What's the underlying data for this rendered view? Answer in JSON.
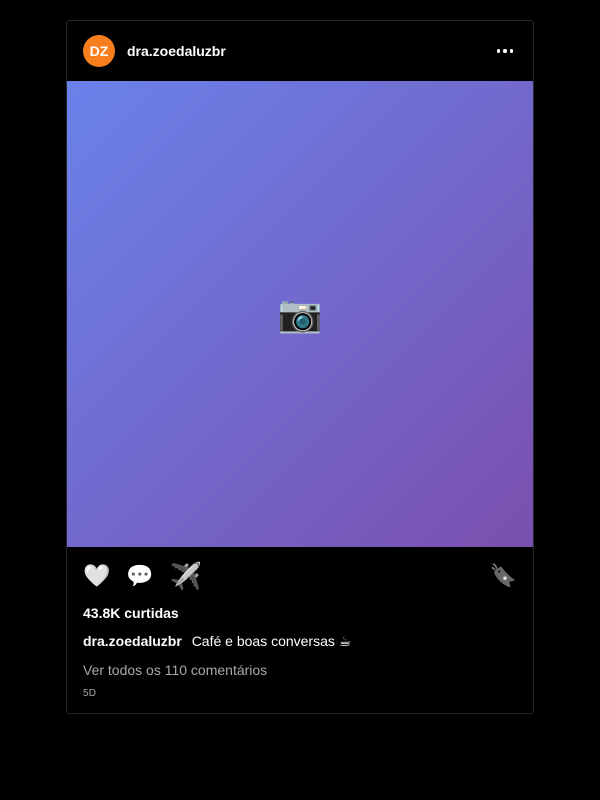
{
  "post": {
    "avatar_initials": "DZ",
    "avatar_color": "#f77f1e",
    "username": "dra.zoedaluzbr",
    "media_emoji": "📷",
    "media_gradient": [
      "#6a82ea",
      "#7a4fae"
    ],
    "icons": {
      "like": "🤍",
      "comment": "💬",
      "share": "✈️",
      "save": "🔖"
    },
    "likes": "43.8K curtidas",
    "caption_user": "dra.zoedaluzbr",
    "caption_text": "Café e boas conversas ☕",
    "comments_link": "Ver todos os 110 comentários",
    "timestamp": "5D"
  }
}
